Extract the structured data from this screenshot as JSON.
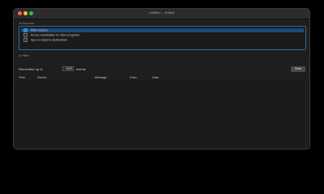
{
  "window": {
    "title": "Untitled — Edited"
  },
  "sources": {
    "header": "Sources",
    "items": [
      {
        "label": "MIDI sources",
        "checked": true,
        "selected": true
      },
      {
        "label": "Act as a destination for other programs",
        "checked": false,
        "selected": false
      },
      {
        "label": "Spy on output to destinations",
        "checked": false,
        "selected": false
      }
    ]
  },
  "filter": {
    "header": "Filter"
  },
  "remember": {
    "prefix": "Remember up to",
    "value": "1000",
    "suffix": "events"
  },
  "clear_button": "Clear",
  "columns": [
    "Time",
    "Source",
    "Message",
    "Chan",
    "Data"
  ],
  "colors": {
    "accent": "#2f6f95",
    "selection": "#1e4a78"
  }
}
